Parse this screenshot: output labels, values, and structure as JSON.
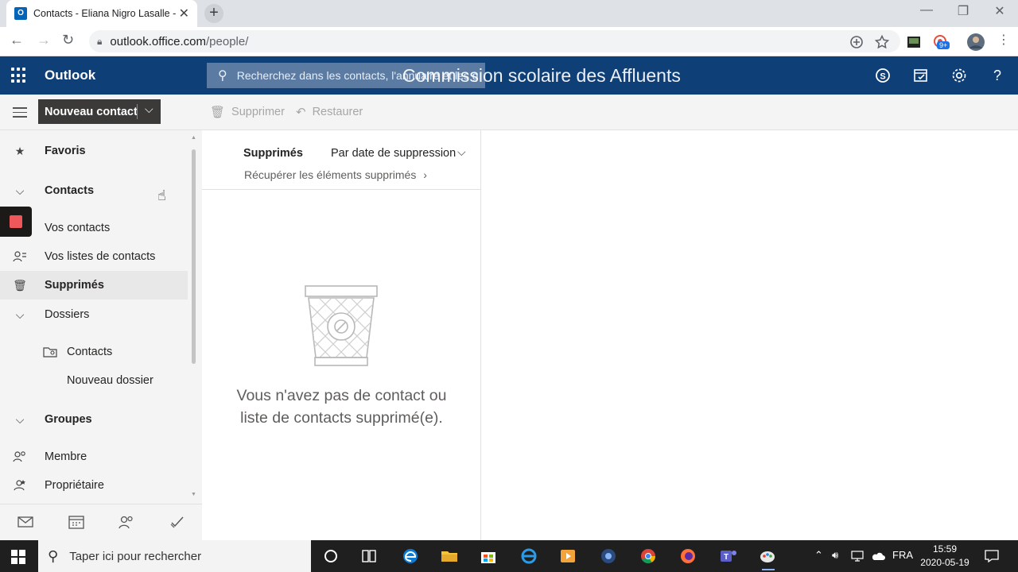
{
  "browser": {
    "tab_title": "Contacts - Eliana Nigro Lasalle - O",
    "tab_close": "✕",
    "new_tab": "+",
    "url_host": "outlook.office.com",
    "url_path": "/people/",
    "notif_badge": "9+"
  },
  "header": {
    "brand": "Outlook",
    "search_placeholder": "Recherchez dans les contacts, l'annuaire et les g",
    "org_name": "Commission scolaire des Affluents"
  },
  "commandbar": {
    "new_contact": "Nouveau contact",
    "delete": "Supprimer",
    "restore": "Restaurer"
  },
  "leftnav": {
    "favoris": "Favoris",
    "contacts": "Contacts",
    "vos_contacts": "Vos contacts",
    "vos_listes": "Vos listes de contacts",
    "supprimes": "Supprimés",
    "dossiers": "Dossiers",
    "dossier_contacts": "Contacts",
    "nouveau_dossier": "Nouveau dossier",
    "groupes": "Groupes",
    "membre": "Membre",
    "proprietaire": "Propriétaire"
  },
  "list": {
    "title": "Supprimés",
    "sort": "Par date de suppression",
    "recover": "Récupérer les éléments supprimés",
    "empty_line1": "Vous n'avez pas de contact ou",
    "empty_line2": "liste de contacts supprimé(e)."
  },
  "taskbar": {
    "search": "Taper ici pour rechercher",
    "lang": "FRA",
    "time": "15:59",
    "date": "2020-05-19"
  },
  "colors": {
    "header_bg": "#0f3f77",
    "accent_red": "#f0575a"
  }
}
